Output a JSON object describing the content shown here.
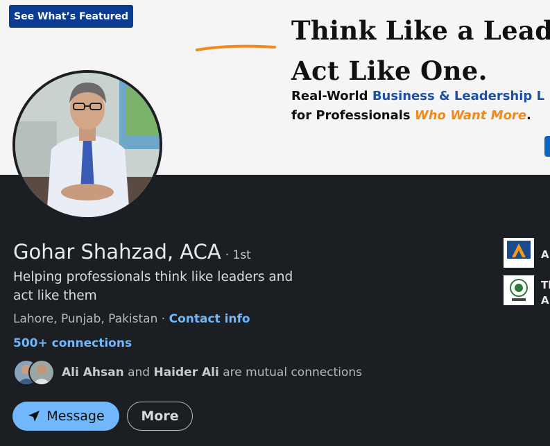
{
  "banner": {
    "featured_button": "See What’s Featured",
    "headline_line1_prefix": "Think Like a ",
    "headline_line1_word": "Lead",
    "headline_line2": "Act Like One.",
    "subline1_prefix": "Real-World ",
    "subline1_highlight": "Business & Leadership L",
    "subline2_prefix": "for Professionals ",
    "subline2_highlight": "Who Want More",
    "subline2_suffix": ".",
    "colors": {
      "navy": "#0a3d91",
      "blue": "#1f4fa3",
      "orange": "#f08a1c"
    }
  },
  "profile": {
    "name": "Gohar Shahzad, ACA",
    "degree": "· 1st",
    "headline": "Helping professionals think like leaders and act like them",
    "location": "Lahore, Punjab, Pakistan",
    "separator": " · ",
    "contact_info": "Contact info",
    "connections": "500+ connections",
    "mutual": {
      "person1": "Ali Ahsan",
      "and": " and ",
      "person2": "Haider Ali",
      "suffix": " are mutual connections"
    }
  },
  "actions": {
    "message": "Message",
    "more": "More"
  },
  "experience": {
    "org1_label": "A",
    "org1_logo_text": "AlliedBank",
    "org2_line1": "Th",
    "org2_line2": "A",
    "org2_logo_text": "ICAP"
  },
  "theme": {
    "accent": "#71b7fb",
    "background": "#1b1f23"
  }
}
